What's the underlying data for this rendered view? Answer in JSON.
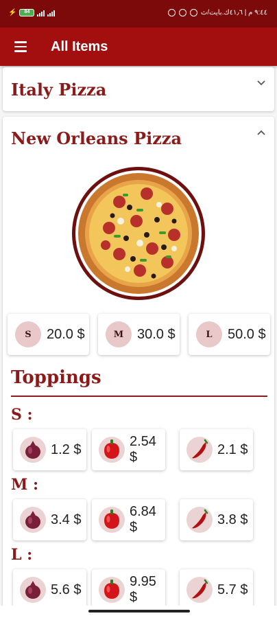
{
  "status_bar": {
    "battery": "84",
    "right_text": "٩:٤٤ م | ٤١٫٦ك.بايت/ث"
  },
  "app_bar": {
    "title": "All Items",
    "menu_icon": "hamburger-menu-icon"
  },
  "categories": [
    {
      "title": "Italy Pizza",
      "expanded": false,
      "icon": "chevron-down-icon"
    },
    {
      "title": "New Orleans Pizza",
      "expanded": true,
      "icon": "chevron-up-icon"
    }
  ],
  "sizes": [
    {
      "letter": "S",
      "price": "20.0 $"
    },
    {
      "letter": "M",
      "price": "30.0 $"
    },
    {
      "letter": "L",
      "price": "50.0 $"
    }
  ],
  "toppings": {
    "title": "Toppings",
    "groups": [
      {
        "label": "S :",
        "items": [
          {
            "icon": "onion-icon",
            "price": "1.2 $"
          },
          {
            "icon": "bell-pepper-icon",
            "price": "2.54 $"
          },
          {
            "icon": "chili-pepper-icon",
            "price": "2.1 $"
          }
        ]
      },
      {
        "label": "M :",
        "items": [
          {
            "icon": "onion-icon",
            "price": "3.4 $"
          },
          {
            "icon": "bell-pepper-icon",
            "price": "6.84 $"
          },
          {
            "icon": "chili-pepper-icon",
            "price": "3.8 $"
          }
        ]
      },
      {
        "label": "L :",
        "items": [
          {
            "icon": "onion-icon",
            "price": "5.6 $"
          },
          {
            "icon": "bell-pepper-icon",
            "price": "9.95 $"
          },
          {
            "icon": "chili-pepper-icon",
            "price": "5.7 $"
          }
        ]
      }
    ]
  },
  "colors": {
    "status_bar": "#7c0a0a",
    "app_bar": "#a30f0f",
    "accent_text": "#8b1a1a",
    "circle_bg": "#e8c8c8"
  }
}
